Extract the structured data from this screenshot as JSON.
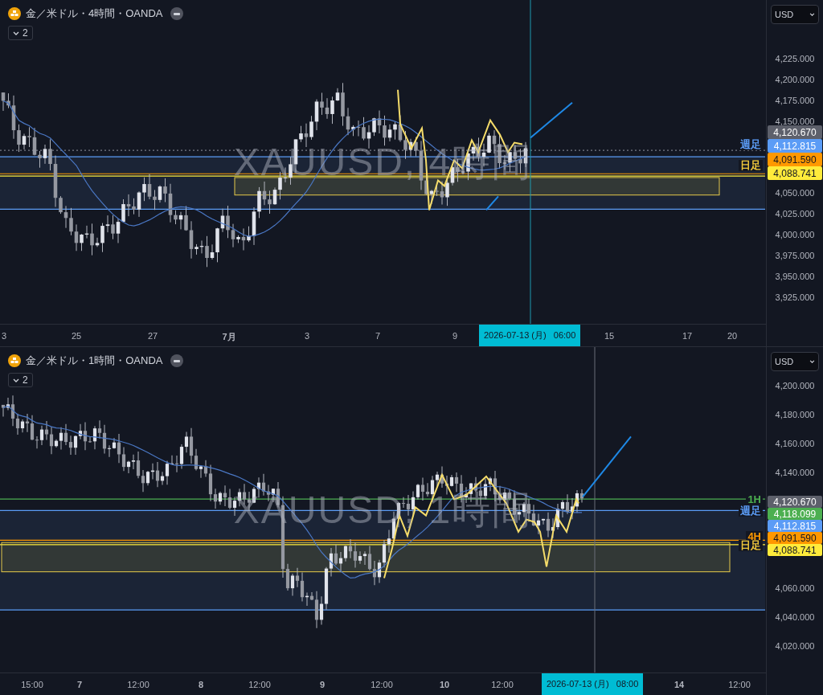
{
  "panes": [
    {
      "title": "金／米ドル・4時間・OANDA",
      "indicator_count": "2",
      "watermark": "XAUUSD, 4時間",
      "currency": "USD",
      "upper_ticks": [
        "4,225.000",
        "4,200.000",
        "4,175.000",
        "4,150.000"
      ],
      "price_tags": [
        {
          "label": "4,120.670",
          "color": "#5d606b"
        },
        {
          "label": "4,112.815",
          "color": "#5b9cf6"
        },
        {
          "label": "4,091.590",
          "color": "#ff9800"
        },
        {
          "label": "4,088.741",
          "color": "#ffeb3b"
        }
      ],
      "lower_ticks": [
        "4,050.000",
        "4,025.000",
        "4,000.000",
        "3,975.000",
        "3,950.000",
        "3,925.000"
      ],
      "line_labels": [
        {
          "label": "週足",
          "color": "#5b9cf6"
        },
        {
          "label": "日足",
          "color": "#f0c83c"
        }
      ],
      "time_labels": [
        {
          "label": "3",
          "emphasized": false
        },
        {
          "label": "25",
          "emphasized": false
        },
        {
          "label": "27",
          "emphasized": false
        },
        {
          "label": "7月",
          "emphasized": true
        },
        {
          "label": "3",
          "emphasized": false
        },
        {
          "label": "7",
          "emphasized": false
        },
        {
          "label": "9",
          "emphasized": false
        },
        {
          "label": "15",
          "emphasized": false
        },
        {
          "label": "17",
          "emphasized": false
        },
        {
          "label": "20",
          "emphasized": false
        }
      ],
      "cursor_time": "2026-07-13 (月)   06:00"
    },
    {
      "title": "金／米ドル・1時間・OANDA",
      "indicator_count": "2",
      "watermark": "XAUUSD, 1時間",
      "currency": "USD",
      "upper_ticks": [
        "4,200.000",
        "4,180.000",
        "4,160.000",
        "4,140.000"
      ],
      "price_tags": [
        {
          "label": "4,120.670",
          "color": "#5d606b"
        },
        {
          "label": "4,118.099",
          "color": "#4caf50"
        },
        {
          "label": "4,112.815",
          "color": "#5b9cf6"
        },
        {
          "label": "4,091.590",
          "color": "#ff9800"
        },
        {
          "label": "4,088.741",
          "color": "#ffeb3b"
        }
      ],
      "lower_ticks": [
        "4,060.000",
        "4,040.000",
        "4,020.000"
      ],
      "line_labels": [
        {
          "label": "1H",
          "color": "#4caf50"
        },
        {
          "label": "週足",
          "color": "#5b9cf6"
        },
        {
          "label": "4H",
          "color": "#ff9800"
        },
        {
          "label": "日足",
          "color": "#f0c83c"
        }
      ],
      "time_labels": [
        {
          "label": "15:00",
          "emphasized": false
        },
        {
          "label": "7",
          "emphasized": true
        },
        {
          "label": "12:00",
          "emphasized": false
        },
        {
          "label": "8",
          "emphasized": true
        },
        {
          "label": "12:00",
          "emphasized": false
        },
        {
          "label": "9",
          "emphasized": true
        },
        {
          "label": "12:00",
          "emphasized": false
        },
        {
          "label": "10",
          "emphasized": true
        },
        {
          "label": "12:00",
          "emphasized": false
        },
        {
          "label": "14",
          "emphasized": true
        },
        {
          "label": "12:00",
          "emphasized": false
        }
      ],
      "cursor_time": "2026-07-13 (月)   08:00"
    }
  ]
}
